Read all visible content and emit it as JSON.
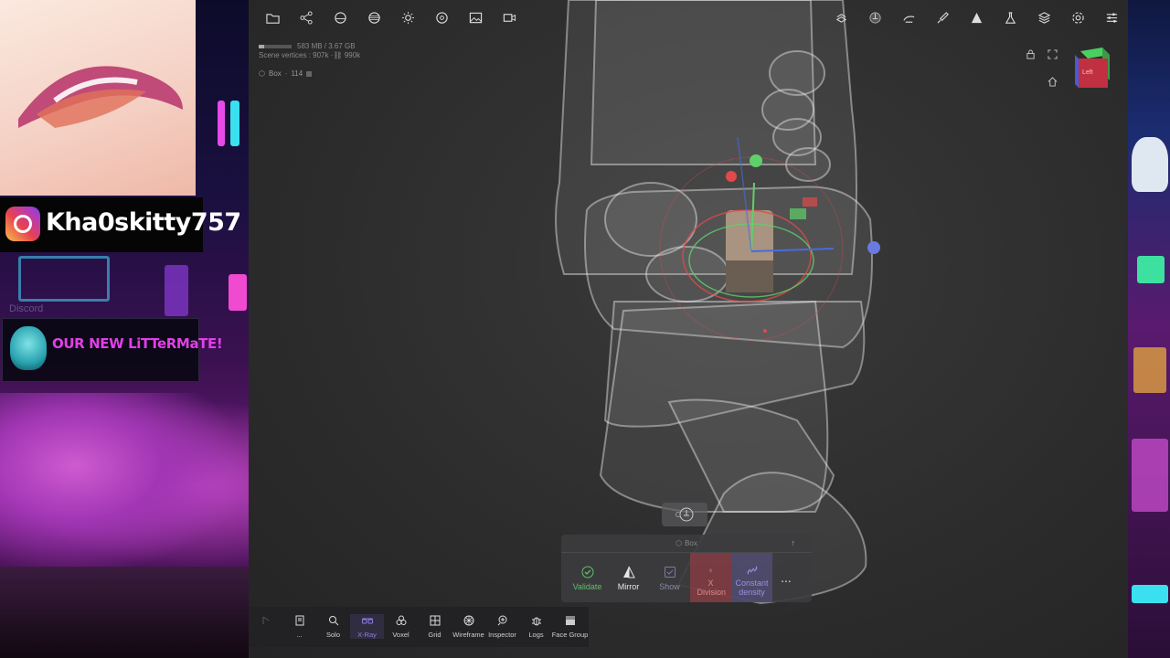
{
  "stream_overlay": {
    "instagram_handle": "Kha0skitty757",
    "discord_faint": "Discord",
    "banner_title": "OUR NEW LiTTeRMaTE!"
  },
  "viewport": {
    "stats": {
      "memory": "583 MB / 3.67 GB",
      "memory_fraction": 0.16,
      "scene_vertices_label": "Scene vertices :",
      "scene_vertices": "907k",
      "scene_vertices_total": "990k"
    },
    "object": {
      "name": "Box",
      "count": "114"
    },
    "view_cube_label": "Left",
    "top_left_toolbar": [
      "folder-icon",
      "share-icon",
      "scene-icon",
      "material-icon",
      "light-icon",
      "shading-icon",
      "background-icon",
      "camera-icon"
    ],
    "top_right_toolbar": [
      "transform-icon",
      "gizmo-icon",
      "paint-icon",
      "brush-icon",
      "symmetry-icon",
      "flask-icon",
      "layers-icon",
      "settings-icon",
      "menu-icon"
    ]
  },
  "tool_popup": {
    "title": "Box",
    "tools": [
      {
        "label": "Validate",
        "icon": "check-icon",
        "color": "#5fbf6a",
        "state": "normal"
      },
      {
        "label": "Mirror",
        "icon": "mirror-icon",
        "color": "#e6e6e6",
        "state": "normal"
      },
      {
        "label": "Show",
        "icon": "checkbox-icon",
        "color": "#7a7ab0",
        "state": "normal"
      },
      {
        "label": "X Division",
        "icon": "division-icon",
        "color": "#d88",
        "state": "active-red"
      },
      {
        "label": "Constant density",
        "icon": "link-icon",
        "color": "#9b8fe0",
        "state": "active-blue"
      }
    ],
    "more_label": "..."
  },
  "bottom_bar": [
    {
      "label": "",
      "icon": "undo-icon",
      "state": "dim"
    },
    {
      "label": "...",
      "icon": "document-icon",
      "state": "normal"
    },
    {
      "label": "Solo",
      "icon": "search-icon",
      "state": "normal"
    },
    {
      "label": "X-Ray",
      "icon": "xray-icon",
      "state": "active"
    },
    {
      "label": "Voxel",
      "icon": "voxel-icon",
      "state": "normal"
    },
    {
      "label": "Grid",
      "icon": "grid-icon",
      "state": "normal"
    },
    {
      "label": "Wireframe",
      "icon": "wireframe-icon",
      "state": "normal"
    },
    {
      "label": "Inspector",
      "icon": "inspector-icon",
      "state": "normal"
    },
    {
      "label": "Logs",
      "icon": "logs-icon",
      "state": "normal"
    },
    {
      "label": "Face Group",
      "icon": "facegroup-icon",
      "state": "normal"
    }
  ],
  "colors": {
    "accent": "#8b7fe0",
    "gizmo_x": "#e04a4a",
    "gizmo_y": "#5fd06a",
    "gizmo_z": "#4a6ae0"
  }
}
